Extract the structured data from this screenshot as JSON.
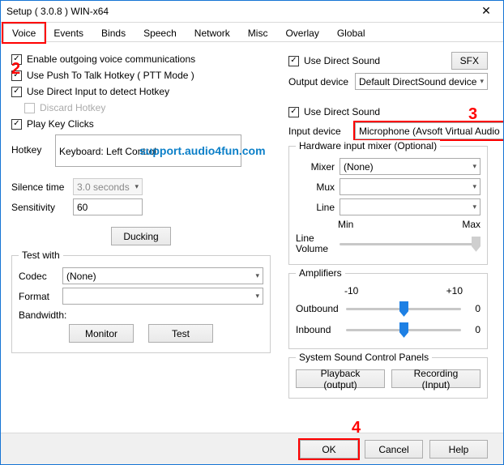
{
  "window": {
    "title": "Setup ( 3.0.8 ) WIN-x64"
  },
  "tabs": [
    "Voice",
    "Events",
    "Binds",
    "Speech",
    "Network",
    "Misc",
    "Overlay",
    "Global"
  ],
  "active_tab": 0,
  "left": {
    "enable_outgoing": "Enable outgoing voice communications",
    "ptt": "Use Push To Talk Hotkey ( PTT Mode )",
    "direct_input_detect": "Use Direct Input to detect Hotkey",
    "discard_hotkey": "Discard Hotkey",
    "play_key_clicks": "Play Key Clicks",
    "hotkey_label": "Hotkey",
    "hotkey_value": "Keyboard: Left Control",
    "silence_label": "Silence time",
    "silence_value": "3.0 seconds",
    "sensitivity_label": "Sensitivity",
    "sensitivity_value": "60",
    "ducking_btn": "Ducking",
    "testwith_legend": "Test with",
    "codec_label": "Codec",
    "codec_value": "(None)",
    "format_label": "Format",
    "format_value": "",
    "bandwidth_label": "Bandwidth:",
    "monitor_btn": "Monitor",
    "test_btn": "Test"
  },
  "right": {
    "output_uds": "Use Direct Sound",
    "sfx_btn": "SFX",
    "output_device_label": "Output device",
    "output_device_value": "Default DirectSound device",
    "input_uds": "Use Direct Sound",
    "input_device_label": "Input device",
    "input_device_value": "Microphone (Avsoft Virtual Audio Device",
    "mixer_legend": "Hardware input mixer (Optional)",
    "mixer_label": "Mixer",
    "mixer_value": "(None)",
    "mux_label": "Mux",
    "mux_value": "",
    "line_label": "Line",
    "line_value": "",
    "min_label": "Min",
    "max_label": "Max",
    "line_volume_label": "Line\nVolume",
    "amplifiers_legend": "Amplifiers",
    "amp_min": "-10",
    "amp_max": "+10",
    "outbound_label": "Outbound",
    "outbound_val": "0",
    "inbound_label": "Inbound",
    "inbound_val": "0",
    "system_panels_legend": "System Sound Control Panels",
    "playback_btn": "Playback (output)",
    "recording_btn": "Recording (Input)"
  },
  "footer": {
    "ok": "OK",
    "cancel": "Cancel",
    "help": "Help"
  },
  "watermark": "support.audio4fun.com",
  "markers": {
    "m2": "2",
    "m3": "3",
    "m4": "4"
  }
}
